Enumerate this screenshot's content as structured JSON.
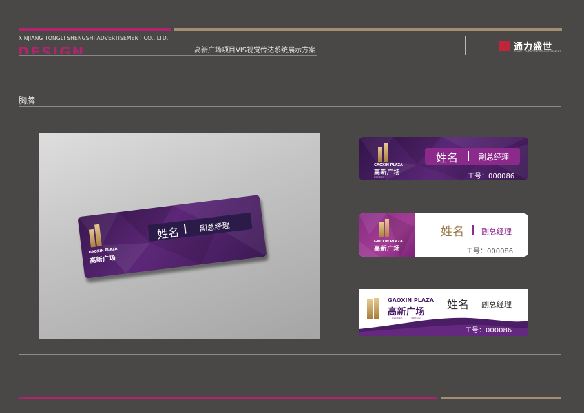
{
  "header": {
    "company": "XINJIANG TONGLI SHENGSHI ADVERTISEMENT CO., LTD.",
    "design_word": "DESIGN",
    "project_title": "高新广场项目VIS视觉传达系统展示方案",
    "brand_name": "通力盛世",
    "brand_sub": "TONGLI SHENGSHI ADVERTISEMENT",
    "brand_seal": "通力"
  },
  "section": {
    "title": "胸牌"
  },
  "badge": {
    "logo_en": "GAOXIN PLAZA",
    "logo_cn": "高新广场",
    "logo_tag": "城市CBD典范",
    "logo_tag2": "金融商务中心",
    "name": "姓名",
    "separator": "I",
    "position": "副总经理",
    "id_label": "工号：000086"
  },
  "colors": {
    "accent_pink": "#b0246e",
    "accent_tan": "#a38e73",
    "purple_dark": "#3a1751",
    "purple_mid": "#5b2778",
    "magenta": "#8c2a8c",
    "gold": "#c9a066"
  }
}
